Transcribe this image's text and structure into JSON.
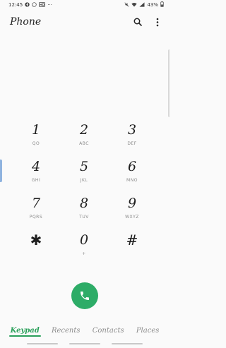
{
  "status_bar": {
    "time": "12:45",
    "left_icons": [
      "facebook-icon",
      "whatsapp-icon",
      "hd-icon"
    ],
    "more": "···",
    "right_icons": [
      "mute-icon",
      "wifi-icon",
      "signal-icon"
    ],
    "battery": "43%"
  },
  "header": {
    "title": "Phone",
    "actions": [
      "search-icon",
      "more-options-icon"
    ]
  },
  "keypad": {
    "keys": [
      {
        "digit": "1",
        "letters": "QO"
      },
      {
        "digit": "2",
        "letters": "ABC"
      },
      {
        "digit": "3",
        "letters": "DEF"
      },
      {
        "digit": "4",
        "letters": "GHI"
      },
      {
        "digit": "5",
        "letters": "JKL"
      },
      {
        "digit": "6",
        "letters": "MNO"
      },
      {
        "digit": "7",
        "letters": "PQRS"
      },
      {
        "digit": "8",
        "letters": "TUV"
      },
      {
        "digit": "9",
        "letters": "WXYZ"
      },
      {
        "digit": "✱",
        "letters": ""
      },
      {
        "digit": "0",
        "letters": "+"
      },
      {
        "digit": "#",
        "letters": ""
      }
    ]
  },
  "call": {
    "icon": "phone-icon",
    "color": "#2dac67"
  },
  "tabs": [
    {
      "label": "Keypad",
      "active": true
    },
    {
      "label": "Recents",
      "active": false
    },
    {
      "label": "Contacts",
      "active": false
    },
    {
      "label": "Places",
      "active": false
    }
  ],
  "colors": {
    "accent": "#2aa05a",
    "call_button": "#2dac67",
    "background": "#fafafa"
  }
}
